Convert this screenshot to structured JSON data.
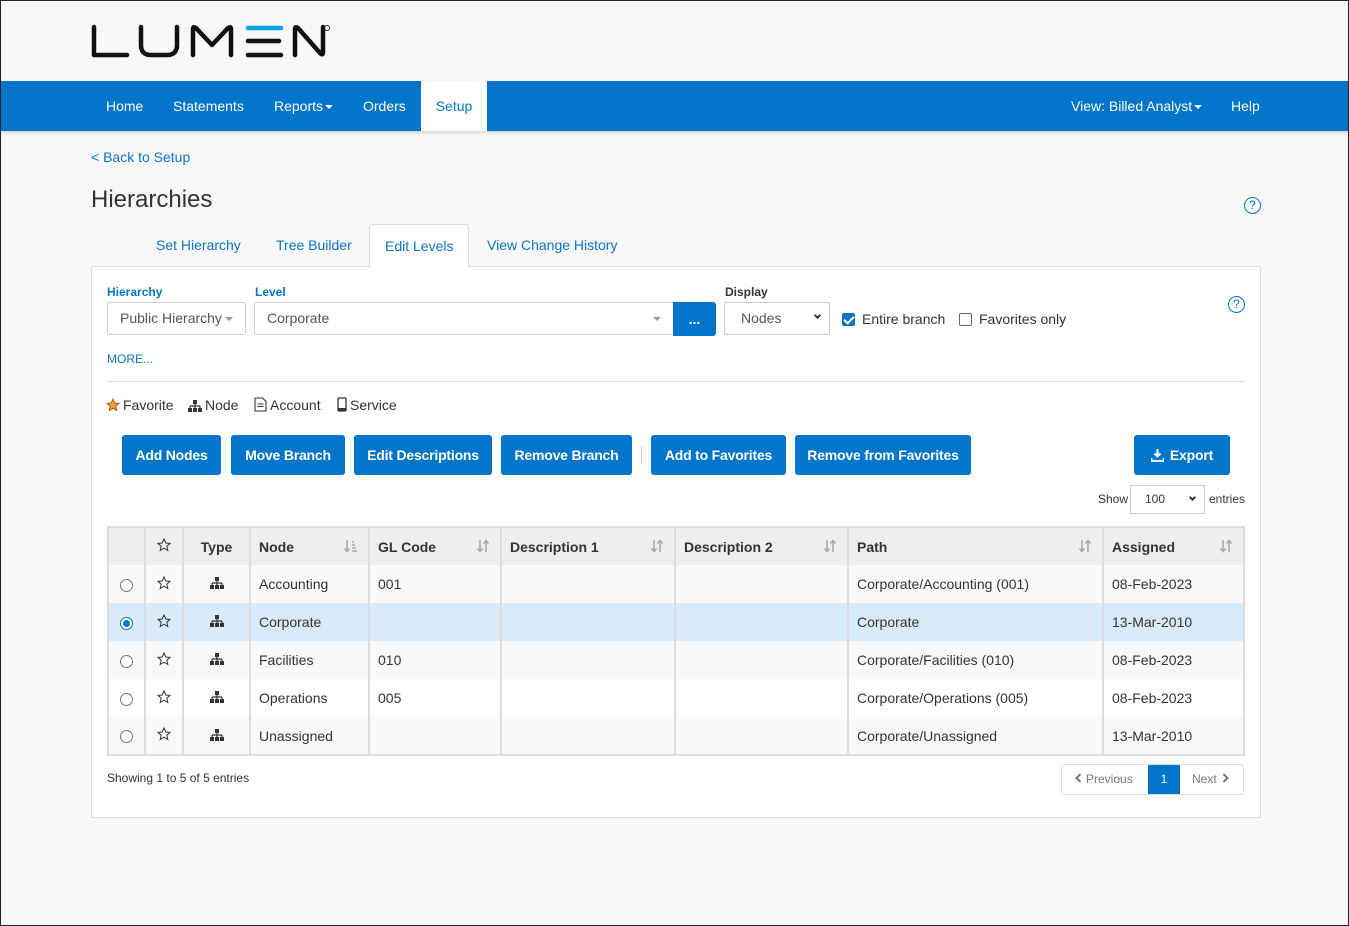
{
  "brand": {
    "name": "LUMEN",
    "accent": "#0075c9"
  },
  "nav": {
    "items": [
      {
        "label": "Home",
        "dropdown": false,
        "active": false
      },
      {
        "label": "Statements",
        "dropdown": false,
        "active": false
      },
      {
        "label": "Reports",
        "dropdown": true,
        "active": false
      },
      {
        "label": "Orders",
        "dropdown": false,
        "active": false
      },
      {
        "label": "Setup",
        "dropdown": false,
        "active": true
      }
    ],
    "view_label": "View: Billed Analyst",
    "help_label": "Help"
  },
  "back_link": "< Back to Setup",
  "page_title": "Hierarchies",
  "help_icon": "?",
  "tabs": [
    {
      "label": "Set Hierarchy",
      "active": false
    },
    {
      "label": "Tree Builder",
      "active": false
    },
    {
      "label": "Edit Levels",
      "active": true
    },
    {
      "label": "View Change History",
      "active": false
    }
  ],
  "filters": {
    "hierarchy_label": "Hierarchy",
    "hierarchy_value": "Public Hierarchy",
    "level_label": "Level",
    "level_value": "Corporate",
    "level_button": "...",
    "display_label": "Display",
    "display_value": "Nodes",
    "entire_branch_label": "Entire branch",
    "entire_branch_checked": true,
    "favorites_only_label": "Favorites only",
    "favorites_only_checked": false,
    "more_link": "MORE..."
  },
  "legend": [
    {
      "icon": "star-filled-icon",
      "label": "Favorite"
    },
    {
      "icon": "node-icon",
      "label": "Node"
    },
    {
      "icon": "account-document-icon",
      "label": "Account"
    },
    {
      "icon": "mobile-device-icon",
      "label": "Service"
    }
  ],
  "actions": {
    "add_nodes": "Add Nodes",
    "move_branch": "Move Branch",
    "edit_descriptions": "Edit Descriptions",
    "remove_branch": "Remove Branch",
    "add_to_favorites": "Add to Favorites",
    "remove_from_favorites": "Remove from Favorites",
    "export": "Export"
  },
  "page_length": {
    "show_label": "Show",
    "value": "100",
    "entries_label": "entries"
  },
  "table": {
    "columns": [
      "",
      "☆",
      "Type",
      "Node",
      "GL Code",
      "Description 1",
      "Description 2",
      "Path",
      "Assigned"
    ],
    "rows": [
      {
        "selected": false,
        "favorite": false,
        "type": "node",
        "node": "Accounting",
        "gl_code": "001",
        "description1": "",
        "description2": "",
        "path": "Corporate/Accounting (001)",
        "assigned": "08-Feb-2023"
      },
      {
        "selected": true,
        "favorite": false,
        "type": "node",
        "node": "Corporate",
        "gl_code": "",
        "description1": "",
        "description2": "",
        "path": "Corporate",
        "assigned": "13-Mar-2010"
      },
      {
        "selected": false,
        "favorite": false,
        "type": "node",
        "node": "Facilities",
        "gl_code": "010",
        "description1": "",
        "description2": "",
        "path": "Corporate/Facilities (010)",
        "assigned": "08-Feb-2023"
      },
      {
        "selected": false,
        "favorite": false,
        "type": "node",
        "node": "Operations",
        "gl_code": "005",
        "description1": "",
        "description2": "",
        "path": "Corporate/Operations (005)",
        "assigned": "08-Feb-2023"
      },
      {
        "selected": false,
        "favorite": false,
        "type": "node",
        "node": "Unassigned",
        "gl_code": "",
        "description1": "",
        "description2": "",
        "path": "Corporate/Unassigned",
        "assigned": "13-Mar-2010"
      }
    ]
  },
  "footer": {
    "showing": "Showing 1 to 5 of 5 entries",
    "pagination": {
      "previous": "Previous",
      "current": "1",
      "next": "Next"
    }
  }
}
